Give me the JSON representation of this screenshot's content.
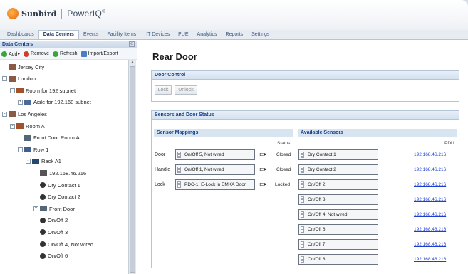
{
  "app": {
    "brand": "Sunbird",
    "product": "PowerIQ",
    "trademark": "®"
  },
  "nav": {
    "tabs": [
      "Dashboards",
      "Data Centers",
      "Events",
      "Facility Items",
      "IT Devices",
      "PUE",
      "Analytics",
      "Reports",
      "Settings"
    ],
    "active": "Data Centers"
  },
  "sidebar": {
    "title": "Data Centers",
    "collapse_glyph": "«",
    "toolbar": {
      "add": "Add▾",
      "remove": "Remove",
      "refresh": "Refresh",
      "import_export": "Import/Export"
    },
    "tree": [
      {
        "label": "Jersey City",
        "level": 0,
        "icon": "datacenter-icon",
        "expander": ""
      },
      {
        "label": "London",
        "level": 0,
        "icon": "datacenter-icon",
        "expander": "-"
      },
      {
        "label": "Room for 192 subnet",
        "level": 1,
        "icon": "room-icon",
        "expander": "-"
      },
      {
        "label": "Aisle for 192.168 subnet",
        "level": 2,
        "icon": "aisle-icon",
        "expander": "+"
      },
      {
        "label": "Los Angeles",
        "level": 0,
        "icon": "datacenter-icon",
        "expander": "-"
      },
      {
        "label": "Room A",
        "level": 1,
        "icon": "room-icon",
        "expander": "-"
      },
      {
        "label": "Front Door Room A",
        "level": 2,
        "icon": "door-icon",
        "expander": ""
      },
      {
        "label": "Row 1",
        "level": 2,
        "icon": "row-icon",
        "expander": "-"
      },
      {
        "label": "Rack A1",
        "level": 3,
        "icon": "rack-icon",
        "expander": "-"
      },
      {
        "label": "192.168.46.216",
        "level": 4,
        "icon": "pdu-icon",
        "expander": ""
      },
      {
        "label": "Dry Contact 1",
        "level": 4,
        "icon": "sensor-icon",
        "expander": ""
      },
      {
        "label": "Dry Contact 2",
        "level": 4,
        "icon": "sensor-icon",
        "expander": ""
      },
      {
        "label": "Front Door",
        "level": 4,
        "icon": "door-icon",
        "expander": "+"
      },
      {
        "label": "On/Off 2",
        "level": 4,
        "icon": "sensor-icon",
        "expander": ""
      },
      {
        "label": "On/Off 3",
        "level": 4,
        "icon": "sensor-icon",
        "expander": ""
      },
      {
        "label": "On/Off 4, Not wired",
        "level": 4,
        "icon": "sensor-icon",
        "expander": ""
      },
      {
        "label": "On/Off 6",
        "level": 4,
        "icon": "sensor-icon",
        "expander": ""
      }
    ]
  },
  "main": {
    "title": "Rear Door",
    "door_control": {
      "title": "Door Control",
      "lock": "Lock",
      "unlock": "Unlock"
    },
    "sensors_panel": {
      "title": "Sensors and Door Status",
      "mappings_title": "Sensor Mappings",
      "status_header": "Status",
      "mappings": [
        {
          "label": "Door",
          "sensor": "On/Off 5, Not wired",
          "status": "Closed"
        },
        {
          "label": "Handle",
          "sensor": "On/Off 1, Not wired",
          "status": "Closed"
        },
        {
          "label": "Lock",
          "sensor": "PDC-1, E-Lock in EMKA Door",
          "status": "Locked"
        }
      ],
      "available_title": "Available Sensors",
      "pdu_header": "PDU",
      "available": [
        {
          "sensor": "Dry Contact 1",
          "pdu": "192.168.46.216"
        },
        {
          "sensor": "Dry Contact 2",
          "pdu": "192.168.46.216"
        },
        {
          "sensor": "On/Off 2",
          "pdu": "192.168.46.216"
        },
        {
          "sensor": "On/Off 3",
          "pdu": "192.168.46.216"
        },
        {
          "sensor": "On/Off 4, Not wired",
          "pdu": "192.168.46.216"
        },
        {
          "sensor": "On/Off 6",
          "pdu": "192.168.46.216"
        },
        {
          "sensor": "On/Off 7",
          "pdu": "192.168.46.216"
        },
        {
          "sensor": "On/Off 8",
          "pdu": "192.168.46.216"
        }
      ]
    }
  }
}
